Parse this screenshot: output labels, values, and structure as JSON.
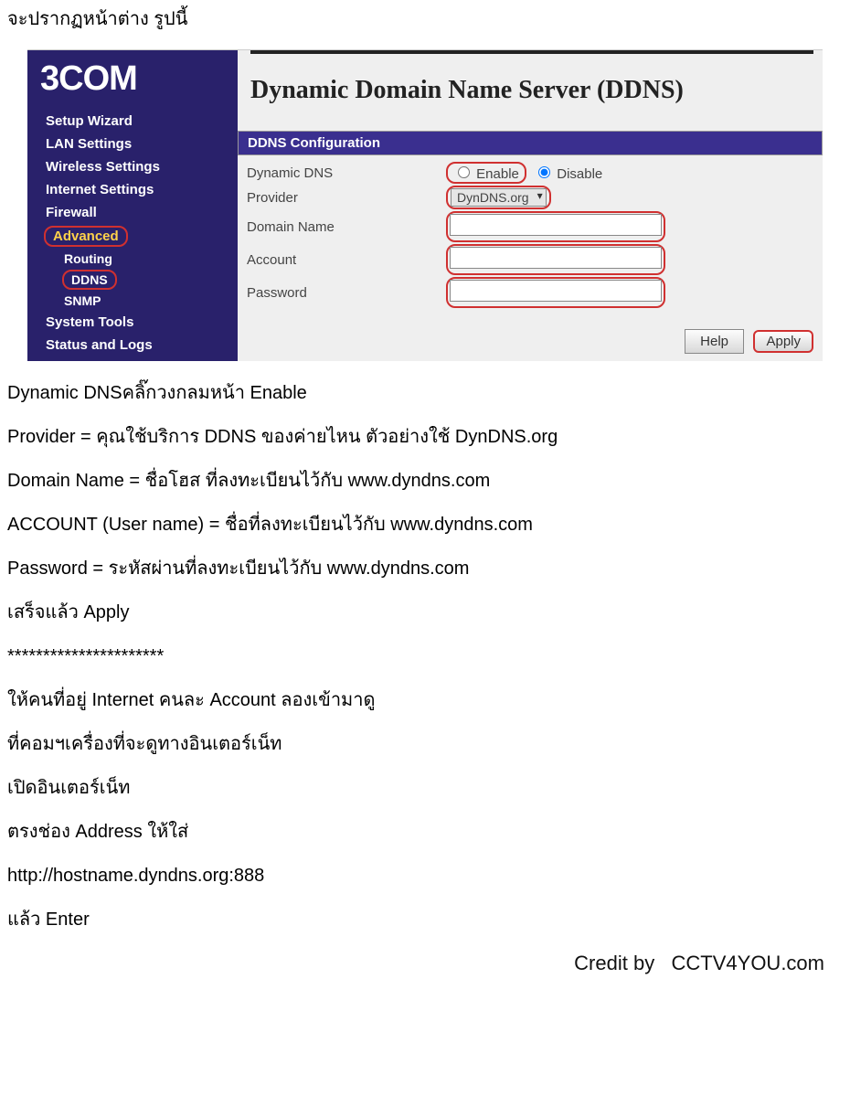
{
  "intro": "จะปรากฏหน้าต่าง รูปนี้",
  "screenshot": {
    "logo": "3COM",
    "menu": {
      "setup_wizard": "Setup Wizard",
      "lan_settings": "LAN Settings",
      "wireless_settings": "Wireless Settings",
      "internet_settings": "Internet Settings",
      "firewall": "Firewall",
      "advanced": "Advanced",
      "routing": "Routing",
      "ddns": "DDNS",
      "snmp": "SNMP",
      "system_tools": "System Tools",
      "status_logs": "Status and Logs"
    },
    "heading": "Dynamic Domain Name Server (DDNS)",
    "config": {
      "title": "DDNS Configuration",
      "dynamic_dns_label": "Dynamic DNS",
      "enable": "Enable",
      "disable": "Disable",
      "provider_label": "Provider",
      "provider_value": "DynDNS.org",
      "domain_label": "Domain Name",
      "account_label": "Account",
      "password_label": "Password"
    },
    "buttons": {
      "help": "Help",
      "apply": "Apply"
    }
  },
  "body": {
    "p1": "Dynamic DNSคลิ๊กวงกลมหน้า Enable",
    "p2": "Provider = คุณใช้บริการ DDNS ของค่ายไหน ตัวอย่างใช้ DynDNS.org",
    "p3": "Domain Name = ชื่อโฮส ที่ลงทะเบียนไว้กับ www.dyndns.com",
    "p4": "ACCOUNT (User name) = ชื่อที่ลงทะเบียนไว้กับ www.dyndns.com",
    "p5": "Password = ระหัสผ่านที่ลงทะเบียนไว้กับ www.dyndns.com",
    "p6": "เสร็จแล้ว Apply",
    "p7": "**********************",
    "p8": "ให้คนที่อยู่ Internet คนละ Account ลองเข้ามาดู",
    "p9": "ที่คอมฯเครื่องที่จะดูทางอินเตอร์เน็ท",
    "p10": "เปิดอินเตอร์เน็ท",
    "p11": "ตรงช่อง Address ให้ใส่",
    "p12": "http://hostname.dyndns.org:888",
    "p13": "แล้ว Enter"
  },
  "credit": "Credit by   CCTV4YOU.com"
}
